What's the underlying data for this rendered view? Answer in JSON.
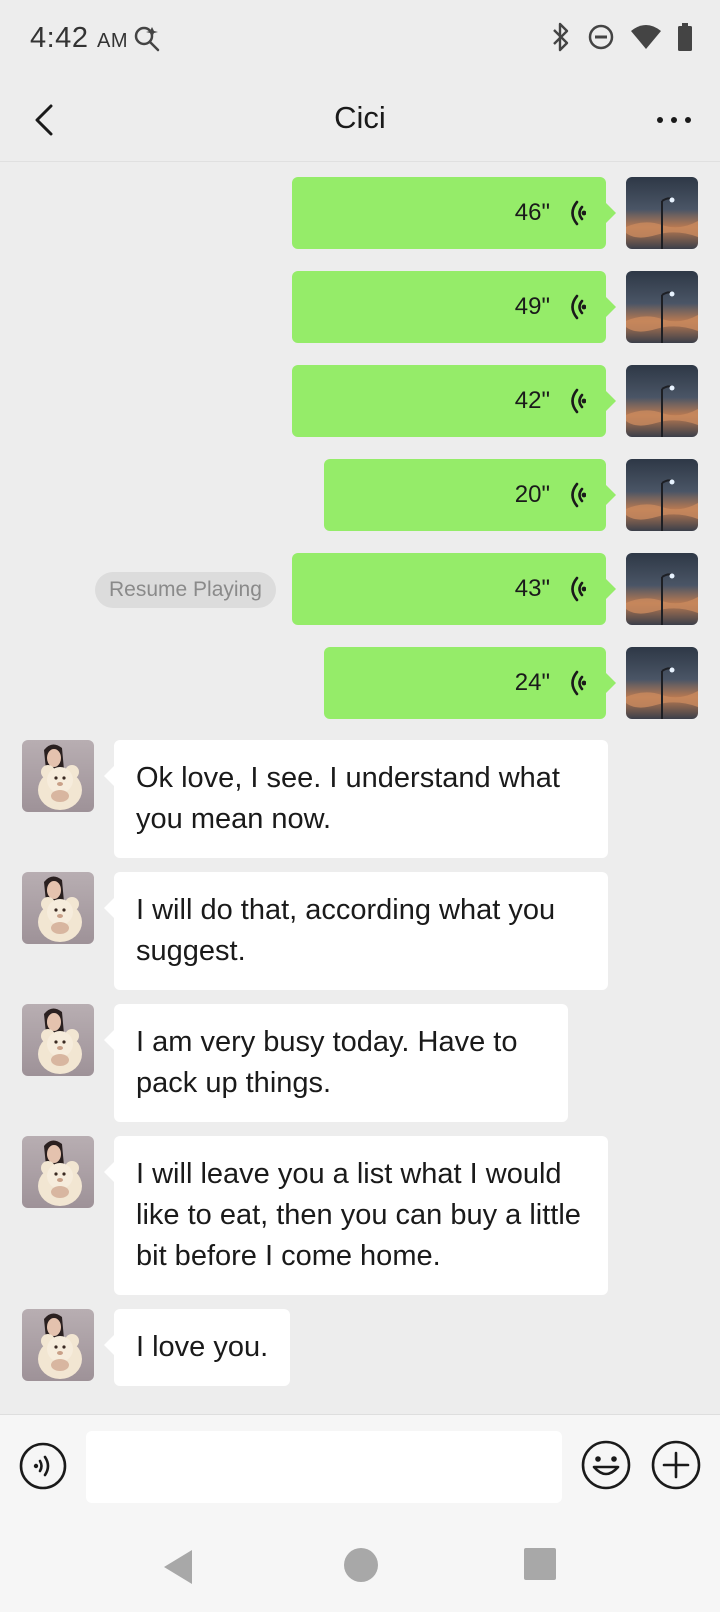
{
  "status_bar": {
    "time": "4:42",
    "ampm": "AM",
    "icons": [
      "search-icon",
      "bluetooth-icon",
      "dnd-icon",
      "wifi-icon",
      "battery-icon"
    ]
  },
  "header": {
    "title": "Cici",
    "back_icon": "chevron-left-icon",
    "more_icon": "more-horizontal-icon"
  },
  "colors": {
    "accent_green": "#95ec69",
    "background": "#ededed",
    "bubble_white": "#ffffff"
  },
  "voice_messages": [
    {
      "duration": "46\""
    },
    {
      "duration": "49\""
    },
    {
      "duration": "42\""
    },
    {
      "duration": "20\""
    },
    {
      "duration": "43\"",
      "resume_label": "Resume Playing"
    },
    {
      "duration": "24\""
    }
  ],
  "text_messages": [
    {
      "text": "Ok love, I see. I understand what you mean now."
    },
    {
      "text": "I will do that, according what you suggest."
    },
    {
      "text": "I am very busy today. Have to pack up things."
    },
    {
      "text": "I will leave you a list what I would like to eat, then you can buy a little bit before I come home."
    },
    {
      "text": "I love you."
    }
  ],
  "input_bar": {
    "placeholder": "",
    "value": "",
    "left_icon": "voice-input-icon",
    "emoji_icon": "emoji-icon",
    "plus_icon": "plus-circle-icon"
  },
  "nav_bar": {
    "icons": [
      "back-triangle-icon",
      "home-circle-icon",
      "recents-square-icon"
    ]
  }
}
